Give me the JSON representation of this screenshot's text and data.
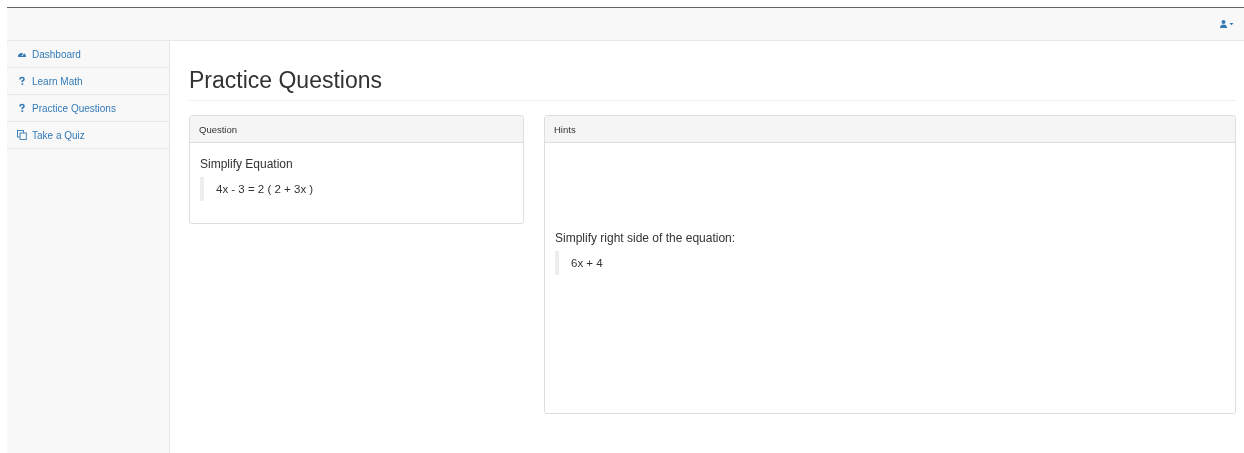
{
  "sidebar": {
    "items": [
      {
        "label": "Dashboard",
        "kind": "dashboard"
      },
      {
        "label": "Learn Math",
        "kind": "question"
      },
      {
        "label": "Practice Questions",
        "kind": "question"
      },
      {
        "label": "Take a Quiz",
        "kind": "copy"
      }
    ]
  },
  "page_title": "Practice Questions",
  "panels": [
    {
      "heading": "Question",
      "text": "Simplify Equation",
      "quote": "4x - 3 = 2 ( 2 + 3x )",
      "kind": "question"
    },
    {
      "heading": "Hints",
      "text": "Simplify right side of the equation:",
      "quote": "6x + 4",
      "kind": "hints"
    }
  ]
}
